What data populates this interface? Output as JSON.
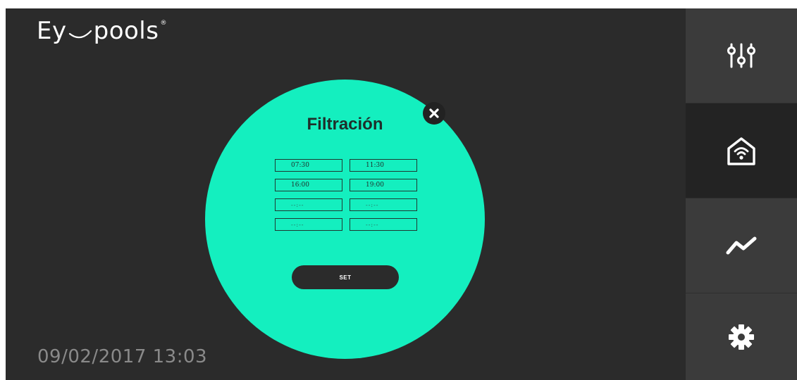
{
  "app": {
    "logo_left": "Ey",
    "logo_right": "pools",
    "logo_mark": "®"
  },
  "status": {
    "datetime": "09/02/2017 13:03"
  },
  "popup": {
    "title": "Filtración",
    "close_icon": "close-icon",
    "schedule": [
      {
        "start": "07:30",
        "end": "11:30"
      },
      {
        "start": "16:00",
        "end": "19:00"
      },
      {
        "start": "--:--",
        "end": "--:--"
      },
      {
        "start": "--:--",
        "end": "--:--"
      }
    ],
    "set_label": "SET"
  },
  "sidebar": {
    "items": [
      {
        "icon": "sliders-icon",
        "active": false
      },
      {
        "icon": "smart-home-icon",
        "active": true
      },
      {
        "icon": "trend-chart-icon",
        "active": false
      },
      {
        "icon": "gear-icon",
        "active": false
      }
    ]
  },
  "colors": {
    "background": "#2b2b2b",
    "accent": "#14efbf",
    "sidebar": "#3b3b3b",
    "sidebar_active": "#232323"
  }
}
